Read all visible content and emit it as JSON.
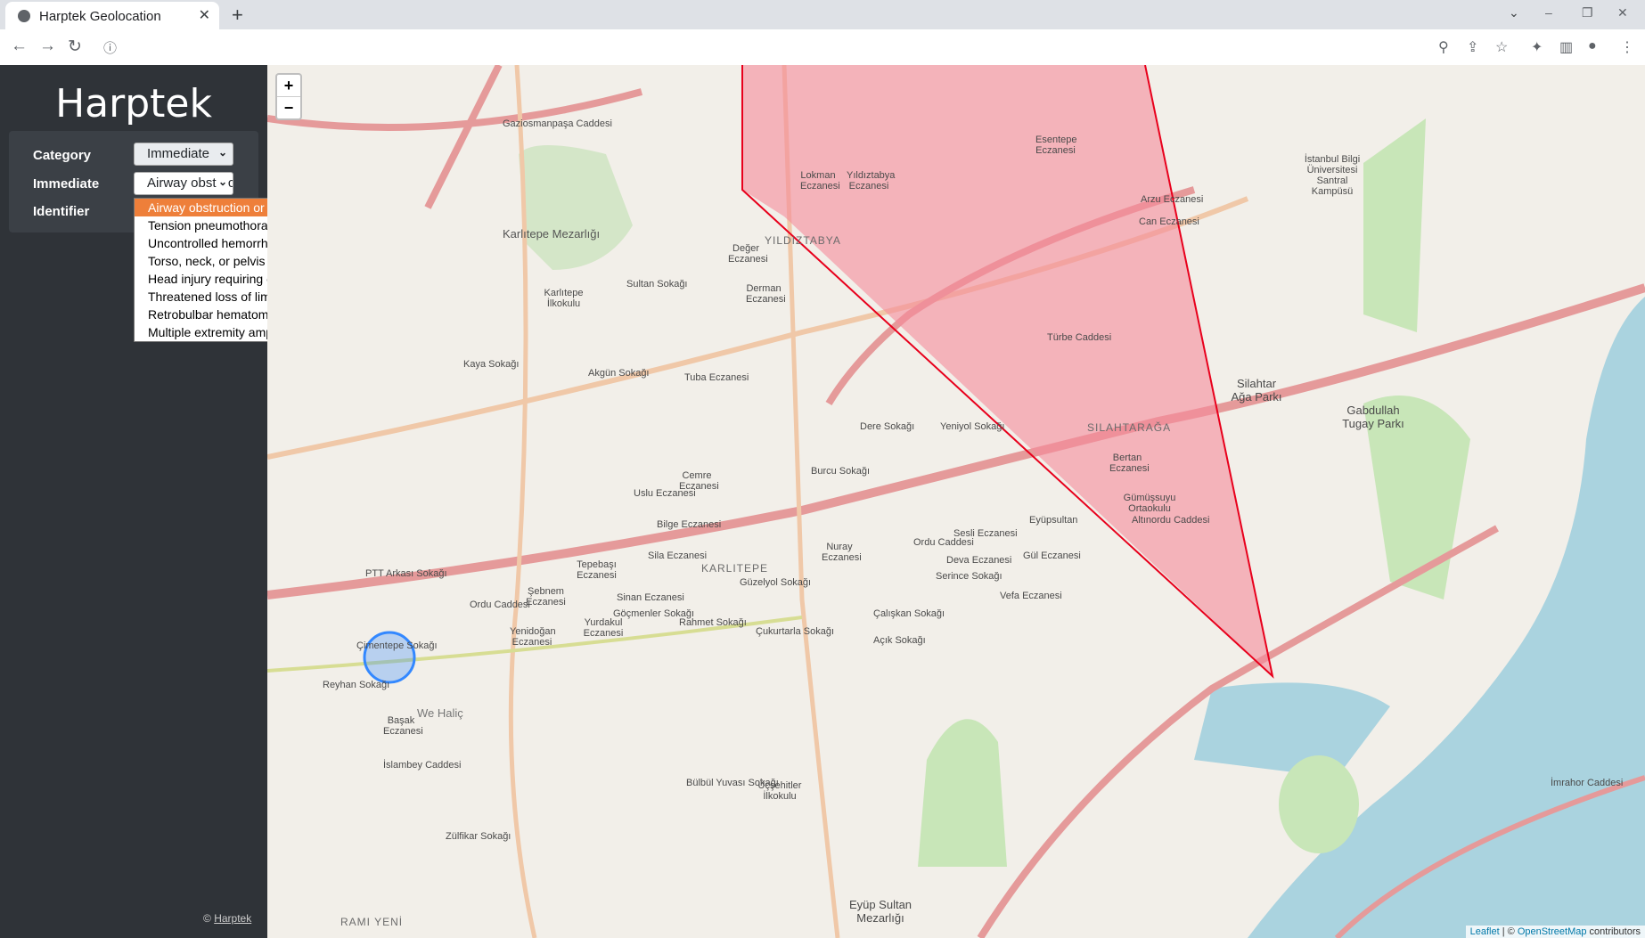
{
  "browser": {
    "tab_title": "Harptek Geolocation",
    "new_tab": "+",
    "tab_list": "⌄",
    "minimize": "–",
    "restore": "❐",
    "close": "✕"
  },
  "app": {
    "brand": "Harptek",
    "form": {
      "category_label": "Category",
      "category_value": "Immediate",
      "immediate_label": "Immediate",
      "immediate_value": "Airway obstruction or potential compromise",
      "identifier_label": "Identifier"
    },
    "dropdown_options": [
      "Airway obstruction or potential compromise",
      "Tension pneumothorax",
      "Uncontrolled hemorrhage",
      "Torso, neck, or pelvis injuries with shock",
      "Head injury requiring emergent decompression",
      "Threatened loss of limb",
      "Retrobulbar hematoma",
      "Multiple extremity amputations"
    ],
    "footer": {
      "copyright": "©",
      "link": "Harptek"
    }
  },
  "map": {
    "zoom_in": "+",
    "zoom_out": "−",
    "attribution": {
      "leaflet": "Leaflet",
      "sep": " | © ",
      "osm": "OpenStreetMap",
      "suffix": " contributors"
    },
    "colors": {
      "polygon_fill": "#f58a9b",
      "polygon_stroke": "#e8001c",
      "water": "#aad3df",
      "park": "#c8e6b8",
      "circle": "#3388ff"
    },
    "labels": {
      "karlitepe_cemetery": "Karlıtepe Mezarlığı",
      "karlitepe": "KARLITEPE",
      "yildiztabya": "YILDIZTABYA",
      "silahtaraga": "SILAHTARAĞA",
      "rami_yeni": "RAMI YENİ",
      "we_halic": "We Haliç",
      "eyup_cemetery": "Eyüp Sultan Mezarlığı",
      "gabdullah": "Gabdullah Tugay Parkı",
      "silahtar_aga": "Silahtar Ağa Parkı",
      "ordu_caddesi": "Ordu Caddesi",
      "gazi_osmanpasa": "Gaziosmanpaşa Caddesi",
      "dere_sokagi": "Dere Sokağı",
      "burcu_sokagi": "Burcu Sokağı",
      "islambey": "İslambey Caddesi",
      "zulfikar": "Zülfikar Sokağı",
      "imrahor": "İmrahor Caddesi",
      "yeniyol": "Yeniyol Sokağı",
      "turbe": "Türbe Caddesi",
      "sultan_sokagi": "Sultan Sokağı",
      "cemre": "Cemre Eczanesi",
      "tuba": "Tuba Eczanesi",
      "derman": "Derman Eczanesi",
      "deger": "Değer Eczanesi",
      "nuray": "Nuray Eczanesi",
      "sesli": "Sesli Eczanesi",
      "deva": "Deva Eczanesi",
      "vefa": "Vefa Eczanesi",
      "gul": "Gül Eczanesi",
      "sila": "Sila Eczanesi",
      "bilge": "Bilge Eczanesi",
      "uslu": "Uslu Eczanesi",
      "serince": "Serince Sokağı",
      "acik": "Açık Sokağı",
      "calıskan": "Çalışkan Sokağı",
      "guzelyol": "Güzelyol Sokağı",
      "cukurtarla": "Çukurtarla Sokağı",
      "rahmet": "Rahmet Sokağı",
      "bulbul": "Bülbül Yuvası Sokağı",
      "kaya": "Kaya Sokağı",
      "sultan_sok": "Sultan Sokağı",
      "akgun": "Akgün Sokağı",
      "basak": "Başak Eczanesi",
      "eyupsultan": "Eyüpsultan",
      "pttarkasi": "PTT Arkası Sokağı",
      "cimentepe": "Çimentepe Sokağı",
      "reyhan": "Reyhan Sokağı",
      "ucsehitler": "Üçşehitler İlkokulu",
      "istanbul_bilgi": "İstanbul Bilgi Üniversitesi Santral Kampüsü",
      "arzu": "Arzu Eczanesi",
      "can": "Can Eczanesi",
      "lokman": "Lokman Eczanesi",
      "yildiztabya_ecz": "Yıldıztabya Eczanesi",
      "esentepe": "Esentepe Eczanesi",
      "bertan": "Bertan Eczanesi",
      "gumussuyu": "Gümüşsuyu Ortaokulu",
      "altinordu": "Altınordu Caddesi",
      "yenidogan": "Yenidoğan Eczanesi",
      "yurdakul": "Yurdakul Eczanesi",
      "sebnem": "Şebnem Eczanesi",
      "tepebasi": "Tepebaşı Eczanesi",
      "sinan": "Sinan Eczanesi",
      "goçmenler": "Göçmenler Sokağı",
      "karlitepe_ilk": "Karlıtepe İlkokulu",
      "isfahan": "Kaya Sokağı"
    }
  }
}
